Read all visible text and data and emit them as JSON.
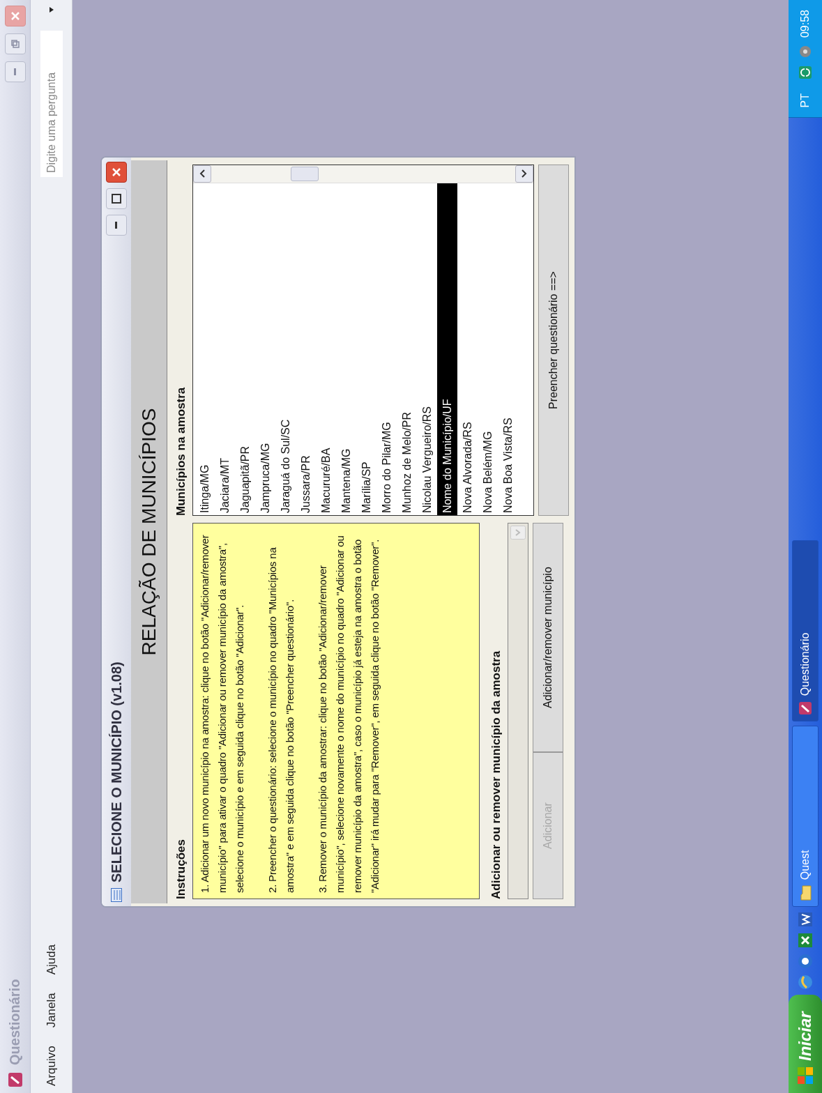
{
  "app_window": {
    "title": "Questionário",
    "menu": [
      {
        "label": "Arquivo"
      },
      {
        "label": "Janela"
      },
      {
        "label": "Ajuda"
      }
    ],
    "help_field": {
      "placeholder": "Digite uma pergunta"
    }
  },
  "dialog": {
    "title": "SELECIONE O MUNICÍPIO (v1.08)",
    "heading": "RELAÇÃO DE MUNICÍPIOS",
    "instructions_label": "Instruções",
    "instructions": [
      "1. Adicionar um novo município na amostra: clique no botão \"Adicionar/remover município\" para ativar o quadro \"Adicionar ou remover município da amostra\", selecione o município e em seguida clique no botão \"Adicionar\".",
      "2. Preencher o questionário: selecione o município no quadro \"Municípios na amostra\" e em seguida clique no botão \"Preencher questionário\".",
      "3. Remover o município da amostrar: clique no botão \"Adicionar/remover município\", selecione novamente o nome do município no quadro \"Adicionar ou remover município da amostra\", caso o município já esteja na amostra o botão \"Adicionar\" irá mudar para \"Remover\", em seguida clique no botão \"Remover\"."
    ],
    "section_label": "Adicionar ou remover município da amostra",
    "combo": {
      "disabled": true
    },
    "buttons": [
      {
        "label": "Adicionar",
        "disabled": true
      },
      {
        "label": "Adicionar/remover município",
        "disabled": false
      }
    ],
    "list_label": "Municípios na amostra",
    "list": [
      {
        "label": "Itinga/MG",
        "selected": false
      },
      {
        "label": "Jaciara/MT",
        "selected": false
      },
      {
        "label": "Jaguapitã/PR",
        "selected": false
      },
      {
        "label": "Jampruca/MG",
        "selected": false
      },
      {
        "label": "Jaraguá do Sul/SC",
        "selected": false
      },
      {
        "label": "Jussara/PR",
        "selected": false
      },
      {
        "label": "Macururé/BA",
        "selected": false
      },
      {
        "label": "Mantena/MG",
        "selected": false
      },
      {
        "label": "Marília/SP",
        "selected": false
      },
      {
        "label": "Morro do Pilar/MG",
        "selected": false
      },
      {
        "label": "Munhoz de Melo/PR",
        "selected": false
      },
      {
        "label": "Nicolau Vergueiro/RS",
        "selected": false
      },
      {
        "label": "Nome do Município/UF",
        "selected": true
      },
      {
        "label": "Nova Alvorada/RS",
        "selected": false
      },
      {
        "label": "Nova Belém/MG",
        "selected": false
      },
      {
        "label": "Nova Boa Vista/RS",
        "selected": false
      }
    ],
    "proceed_button": "Preencher questionário ==>"
  },
  "taskbar": {
    "start": "Iniciar",
    "tasks": [
      {
        "label": "Quest",
        "kind": "folder",
        "selected": false
      },
      {
        "label": "Questionário",
        "kind": "app",
        "selected": true
      }
    ],
    "language": "PT",
    "clock": "09:58"
  }
}
